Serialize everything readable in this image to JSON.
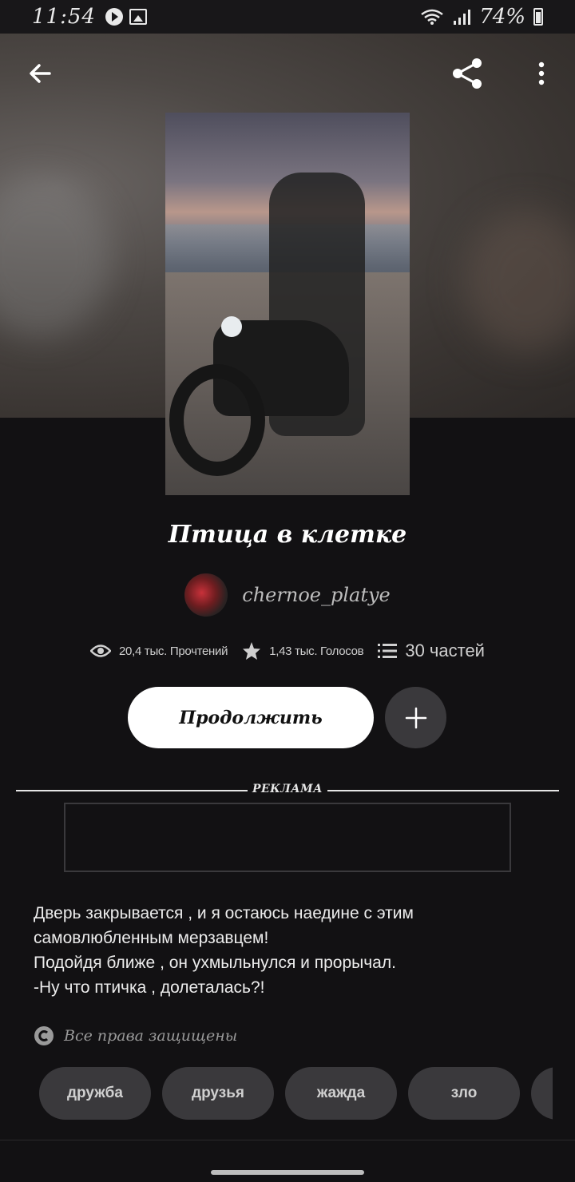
{
  "status_bar": {
    "time": "11:54",
    "battery": "74%",
    "icons": [
      "play-icon",
      "image-icon",
      "wifi-icon",
      "signal-icon",
      "battery-icon"
    ]
  },
  "header": {
    "back_icon": "arrow-left-icon",
    "share_icon": "share-icon",
    "more_icon": "more-vertical-icon"
  },
  "story": {
    "title": "Птица в клетке",
    "author": "chernoe_platye",
    "stats": {
      "reads": "20,4 тыс. Прочтений",
      "votes": "1,43 тыс. Голосов",
      "parts": "30 частей"
    },
    "continue_label": "Продолжить",
    "add_icon": "plus-icon"
  },
  "ad": {
    "label": "РЕКЛАМА"
  },
  "description": {
    "lines": [
      "Дверь закрывается , и я остаюсь наедине с этим самовлюбленным мерзавцем!",
      "Подойдя ближе , он ухмыльнулся и прорычал.",
      "-Ну что птичка , долеталась?!"
    ]
  },
  "copyright": {
    "text": "Все права защищены"
  },
  "tags": [
    "дружба",
    "друзья",
    "жажда",
    "зло",
    ""
  ],
  "colors": {
    "background": "#121113",
    "button_primary": "#ffffff",
    "button_secondary": "#3a393c",
    "text_muted": "#9a9a9a"
  }
}
